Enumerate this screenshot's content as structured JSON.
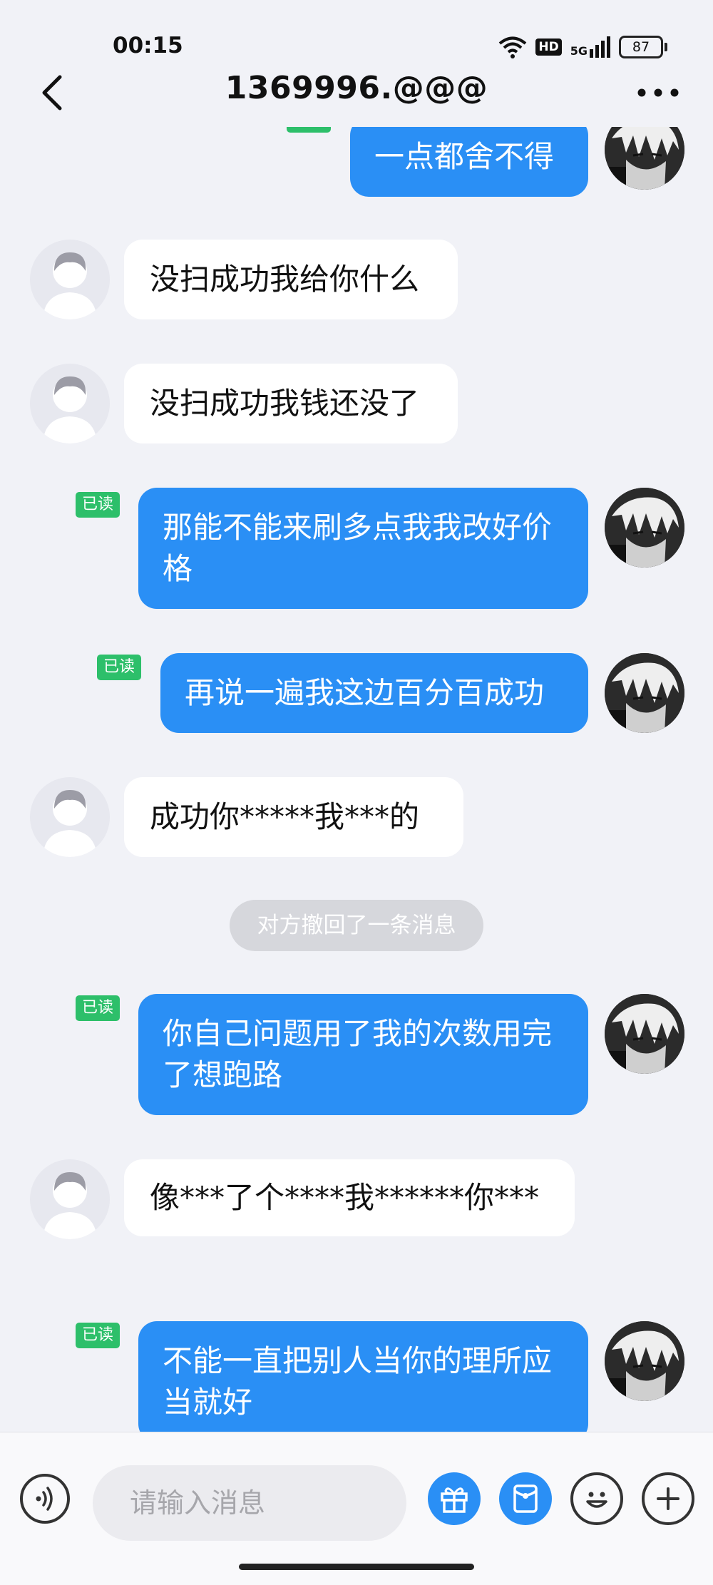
{
  "status_bar": {
    "time": "00:15",
    "network": "5G",
    "hd": "HD",
    "battery": "87",
    "icons": [
      "wifi-icon",
      "hd-icon",
      "signal-icon",
      "battery-icon"
    ]
  },
  "header": {
    "title": "1369996.@@@",
    "back_icon": "chevron-left-icon",
    "more_icon": "more-horizontal-icon"
  },
  "read_label": "已读",
  "messages": [
    {
      "id": "m0",
      "side": "out",
      "text": "一点都舍不得",
      "read": true
    },
    {
      "id": "m1",
      "side": "in",
      "text": "没扫成功我给你什么"
    },
    {
      "id": "m2",
      "side": "in",
      "text": "没扫成功我钱还没了"
    },
    {
      "id": "m3",
      "side": "out",
      "text": "那能不能来刷多点我我改好价格",
      "read": true
    },
    {
      "id": "m4",
      "side": "out",
      "text": "再说一遍我这边百分百成功",
      "read": true
    },
    {
      "id": "m5",
      "side": "in",
      "text": "成功你*****我***的"
    },
    {
      "id": "s1",
      "side": "system",
      "text": "对方撤回了一条消息"
    },
    {
      "id": "m6",
      "side": "out",
      "text": "你自己问题用了我的次数用完了想跑路",
      "read": true
    },
    {
      "id": "m7",
      "side": "in",
      "text": "像***了个****我******你***"
    },
    {
      "id": "m8",
      "side": "out",
      "text": "不能一直把别人当你的理所应当就好",
      "read": true
    }
  ],
  "input_bar": {
    "placeholder": "请输入消息",
    "voice_icon": "voice-icon",
    "gift_icon": "gift-icon",
    "red_packet_icon": "red-packet-icon",
    "emoji_icon": "emoji-icon",
    "plus_icon": "plus-icon"
  },
  "colors": {
    "background": "#f1f2f7",
    "outgoing_bubble": "#2a8ff5",
    "incoming_bubble": "#ffffff",
    "read_badge": "#2dbf6a",
    "system_note": "#d6d7dc"
  }
}
